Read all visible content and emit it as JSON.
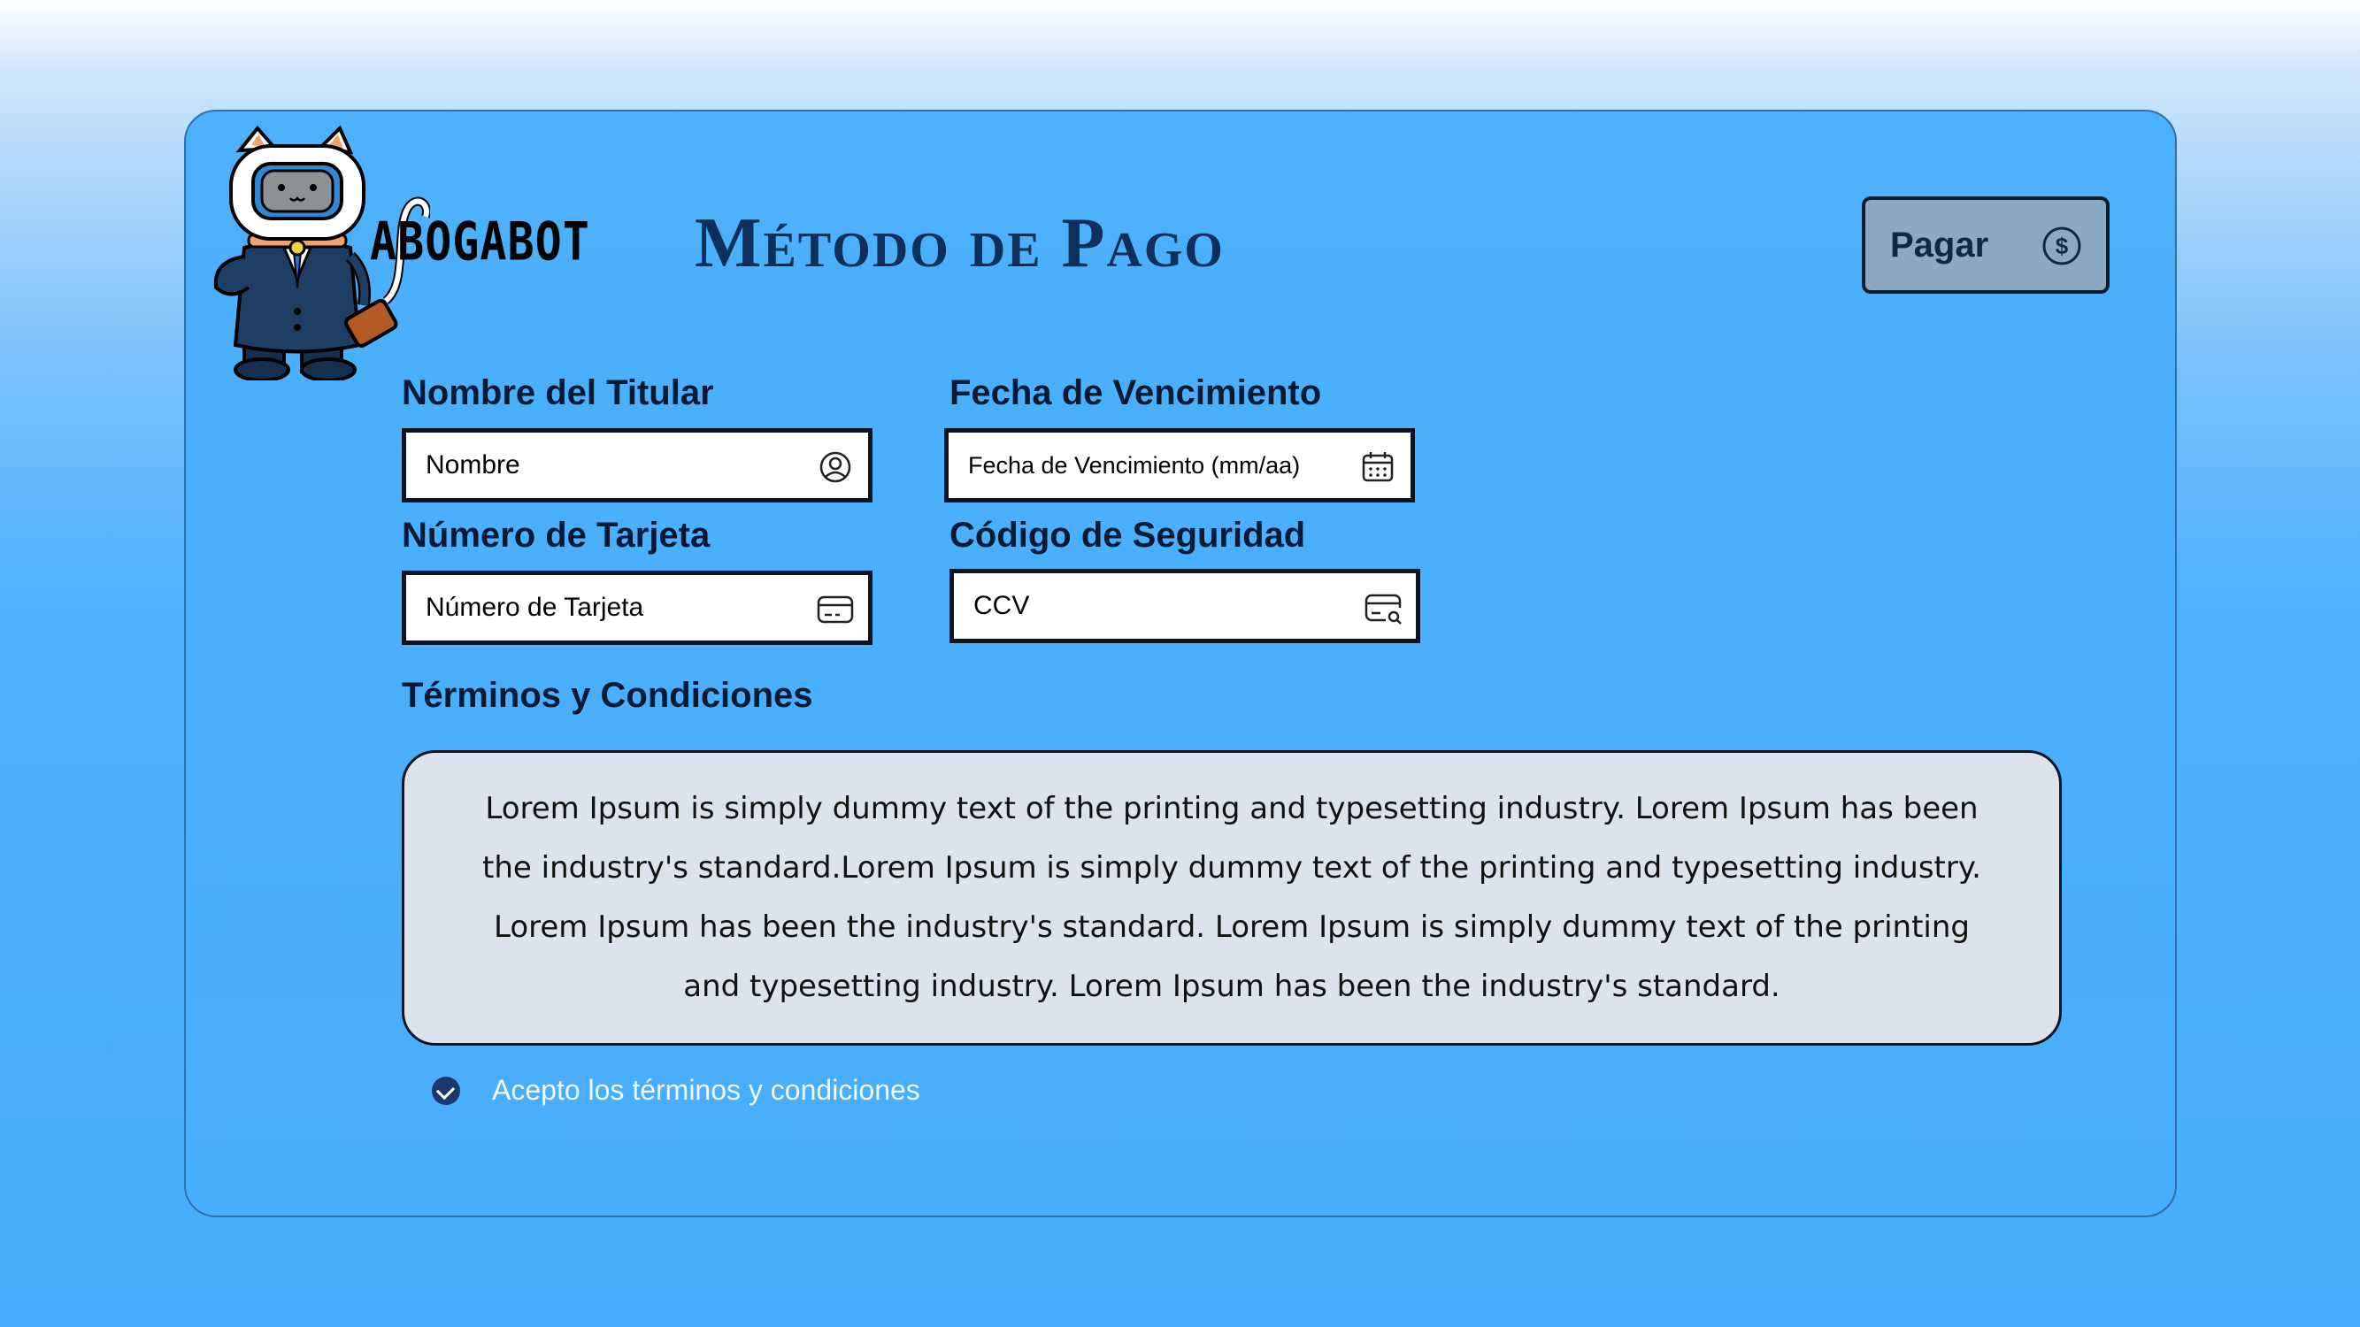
{
  "brand": {
    "logo_text": "ABOGABOT"
  },
  "header": {
    "title": "Método de Pago"
  },
  "pay_button": {
    "label": "Pagar"
  },
  "form": {
    "holder": {
      "label": "Nombre del Titular",
      "placeholder": "Nombre"
    },
    "expiry": {
      "label": "Fecha de Vencimiento",
      "placeholder": "Fecha de Vencimiento (mm/aa)"
    },
    "card_number": {
      "label": "Número de Tarjeta",
      "placeholder": "Número de Tarjeta"
    },
    "security_code": {
      "label": "Código de Seguridad",
      "placeholder": "CCV"
    }
  },
  "terms": {
    "heading": "Términos y Condiciones",
    "body": "Lorem Ipsum is simply dummy text of the printing and typesetting industry. Lorem Ipsum has been the industry's standard.Lorem Ipsum is simply dummy text of the printing and typesetting industry. Lorem Ipsum has been the industry's standard. Lorem Ipsum is simply dummy text of the printing and typesetting industry. Lorem Ipsum has been the industry's standard.",
    "accept_label": "Acepto los términos y condiciones",
    "accepted": true
  },
  "icons": {
    "holder": "user-circle-icon",
    "expiry": "calendar-icon",
    "card_number": "credit-card-icon",
    "security_code": "card-search-icon",
    "pay": "dollar-circle-icon"
  },
  "colors": {
    "background": "#45adfd",
    "card": "#4cb0fb",
    "title": "#0d2f5c",
    "pay_button": "#8da8c1",
    "terms_box": "#dce3ea",
    "checkbox": "#1d3769"
  }
}
